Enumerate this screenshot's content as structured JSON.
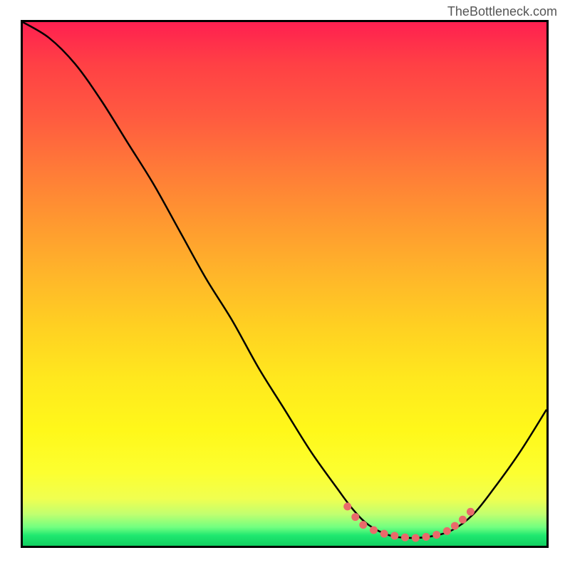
{
  "watermark": "TheBottleneck.com",
  "chart_data": {
    "type": "line",
    "title": "",
    "xlabel": "",
    "ylabel": "",
    "xlim": [
      0,
      100
    ],
    "ylim": [
      0,
      100
    ],
    "curve_points": [
      {
        "x": 0,
        "y": 100
      },
      {
        "x": 5,
        "y": 97
      },
      {
        "x": 10,
        "y": 92
      },
      {
        "x": 15,
        "y": 85
      },
      {
        "x": 20,
        "y": 77
      },
      {
        "x": 25,
        "y": 69
      },
      {
        "x": 30,
        "y": 60
      },
      {
        "x": 35,
        "y": 51
      },
      {
        "x": 40,
        "y": 43
      },
      {
        "x": 45,
        "y": 34
      },
      {
        "x": 50,
        "y": 26
      },
      {
        "x": 55,
        "y": 18
      },
      {
        "x": 60,
        "y": 11
      },
      {
        "x": 63,
        "y": 7
      },
      {
        "x": 66,
        "y": 4
      },
      {
        "x": 70,
        "y": 2
      },
      {
        "x": 74,
        "y": 1.5
      },
      {
        "x": 78,
        "y": 1.8
      },
      {
        "x": 82,
        "y": 3
      },
      {
        "x": 86,
        "y": 6
      },
      {
        "x": 90,
        "y": 11
      },
      {
        "x": 95,
        "y": 18
      },
      {
        "x": 100,
        "y": 26
      }
    ],
    "dots": [
      {
        "x": 62,
        "y": 7.5
      },
      {
        "x": 63.5,
        "y": 5.5
      },
      {
        "x": 65,
        "y": 4
      },
      {
        "x": 67,
        "y": 3
      },
      {
        "x": 69,
        "y": 2.3
      },
      {
        "x": 71,
        "y": 1.9
      },
      {
        "x": 73,
        "y": 1.6
      },
      {
        "x": 75,
        "y": 1.5
      },
      {
        "x": 77,
        "y": 1.7
      },
      {
        "x": 79,
        "y": 2.1
      },
      {
        "x": 81,
        "y": 2.8
      },
      {
        "x": 82.5,
        "y": 3.8
      },
      {
        "x": 84,
        "y": 5
      },
      {
        "x": 85.5,
        "y": 6.5
      }
    ],
    "dot_color": "#e96a6a",
    "gradient_colors": {
      "top": "#ff2050",
      "bottom": "#10d060"
    }
  }
}
